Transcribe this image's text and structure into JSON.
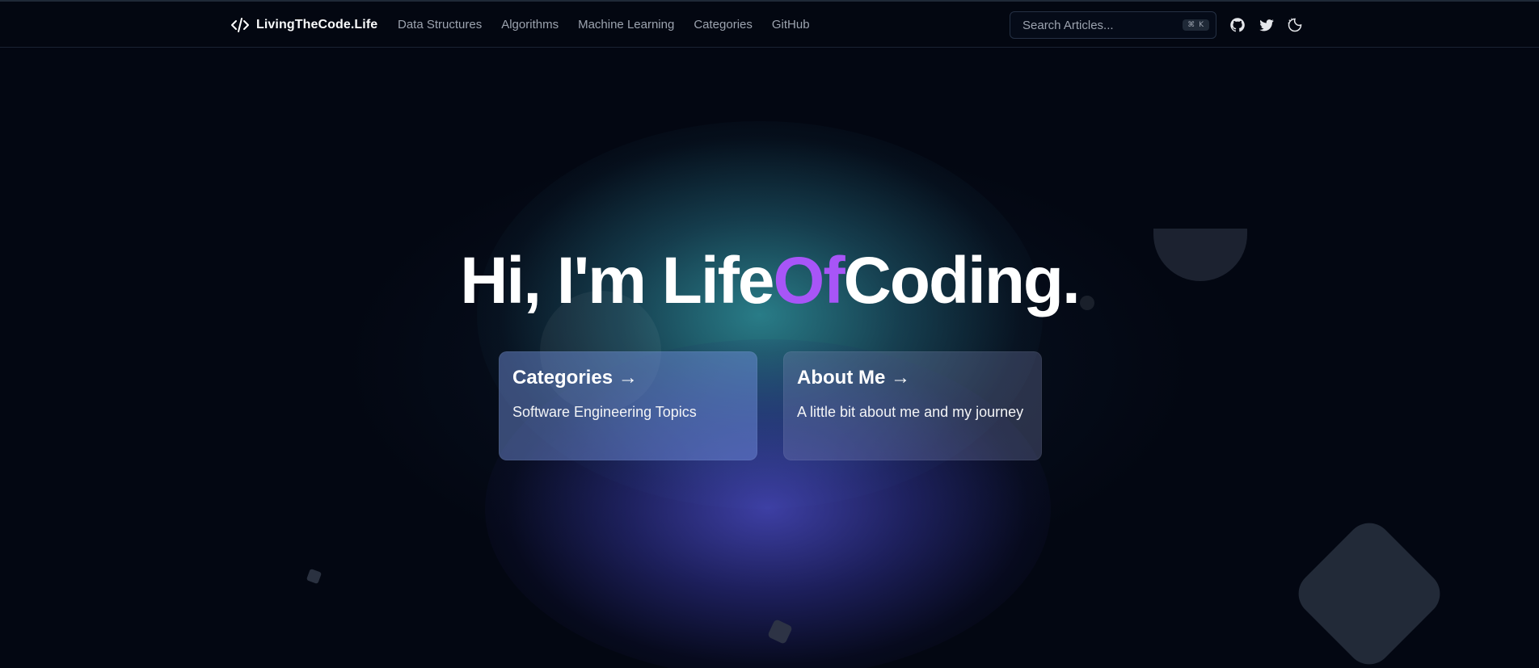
{
  "header": {
    "brand": "LivingTheCode.Life",
    "nav": [
      "Data Structures",
      "Algorithms",
      "Machine Learning",
      "Categories",
      "GitHub"
    ],
    "search_placeholder": "Search Articles...",
    "search_shortcut": "⌘ K",
    "icons": [
      "code-icon",
      "github-icon",
      "twitter-icon",
      "theme-toggle-icon"
    ]
  },
  "hero": {
    "title_prefix": "Hi, I'm Life",
    "title_accent": "Of",
    "title_suffix": "Coding."
  },
  "cards": [
    {
      "title": "Categories →",
      "description": "Software Engineering Topics"
    },
    {
      "title": "About Me →",
      "description": "A little bit about me and my journey"
    }
  ],
  "colors": {
    "background": "#030712",
    "accent": "#a855f7",
    "nav_text": "#9ca3af"
  }
}
